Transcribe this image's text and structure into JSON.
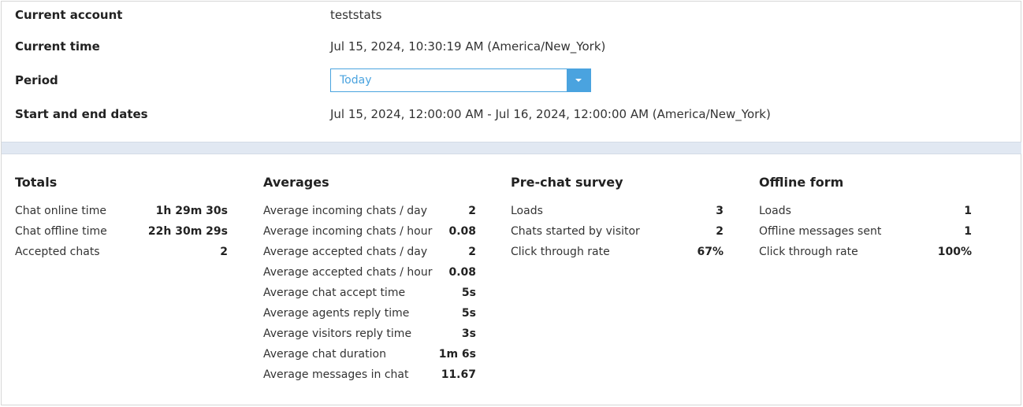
{
  "header": {
    "rows": [
      {
        "label": "Current account",
        "value": "teststats"
      },
      {
        "label": "Current time",
        "value": "Jul 15, 2024, 10:30:19 AM (America/New_York)"
      },
      {
        "label": "Period",
        "value": ""
      },
      {
        "label": "Start and end dates",
        "value": "Jul 15, 2024, 12:00:00 AM - Jul 16, 2024, 12:00:00 AM (America/New_York)"
      }
    ],
    "period_select": {
      "selected": "Today"
    }
  },
  "sections": [
    {
      "title": "Totals",
      "stats": [
        {
          "label": "Chat online time",
          "value": "1h 29m 30s"
        },
        {
          "label": "Chat offline time",
          "value": "22h 30m 29s"
        },
        {
          "label": "Accepted chats",
          "value": "2"
        }
      ]
    },
    {
      "title": "Averages",
      "stats": [
        {
          "label": "Average incoming chats / day",
          "value": "2"
        },
        {
          "label": "Average incoming chats / hour",
          "value": "0.08"
        },
        {
          "label": "Average accepted chats / day",
          "value": "2"
        },
        {
          "label": "Average accepted chats / hour",
          "value": "0.08"
        },
        {
          "label": "Average chat accept time",
          "value": "5s"
        },
        {
          "label": "Average agents reply time",
          "value": "5s"
        },
        {
          "label": "Average visitors reply time",
          "value": "3s"
        },
        {
          "label": "Average chat duration",
          "value": "1m 6s"
        },
        {
          "label": "Average messages in chat",
          "value": "11.67"
        }
      ]
    },
    {
      "title": "Pre-chat survey",
      "stats": [
        {
          "label": "Loads",
          "value": "3"
        },
        {
          "label": "Chats started by visitor",
          "value": "2"
        },
        {
          "label": "Click through rate",
          "value": "67%"
        }
      ]
    },
    {
      "title": "Offline form",
      "stats": [
        {
          "label": "Loads",
          "value": "1"
        },
        {
          "label": "Offline messages sent",
          "value": "1"
        },
        {
          "label": "Click through rate",
          "value": "100%"
        }
      ]
    }
  ],
  "colors": {
    "accent": "#4aa3df",
    "band": "#e1e8f2"
  }
}
